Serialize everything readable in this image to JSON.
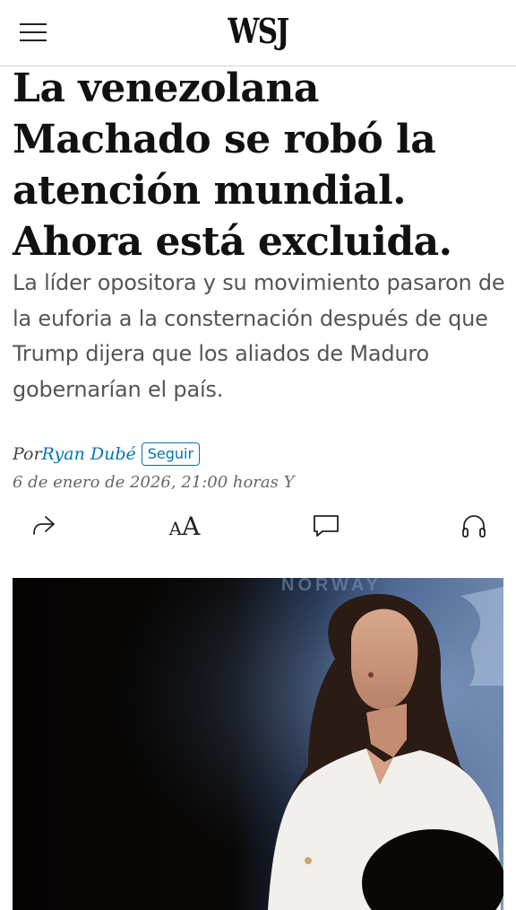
{
  "header": {
    "logo": "WSJ",
    "menu_icon": "hamburger-menu-icon"
  },
  "article": {
    "headline": "La venezolana Machado se robó la atención mundial. Ahora está excluida.",
    "dek": "La líder opositora y su movimiento pasaron de la euforia a la consternación después de que Trump dijera que los aliados de Maduro gobernarían el país.",
    "byline_prefix": "Por",
    "author": "Ryan Dubé",
    "follow_label": "Seguir",
    "date": "6 de enero de 2026, 21:00 horas Y"
  },
  "toolbar": {
    "share_icon": "share-icon",
    "text_size_label": "AA",
    "comments_icon": "comment-icon",
    "listen_icon": "headphones-icon"
  },
  "photo": {
    "backdrop_text": "NORWAY"
  }
}
